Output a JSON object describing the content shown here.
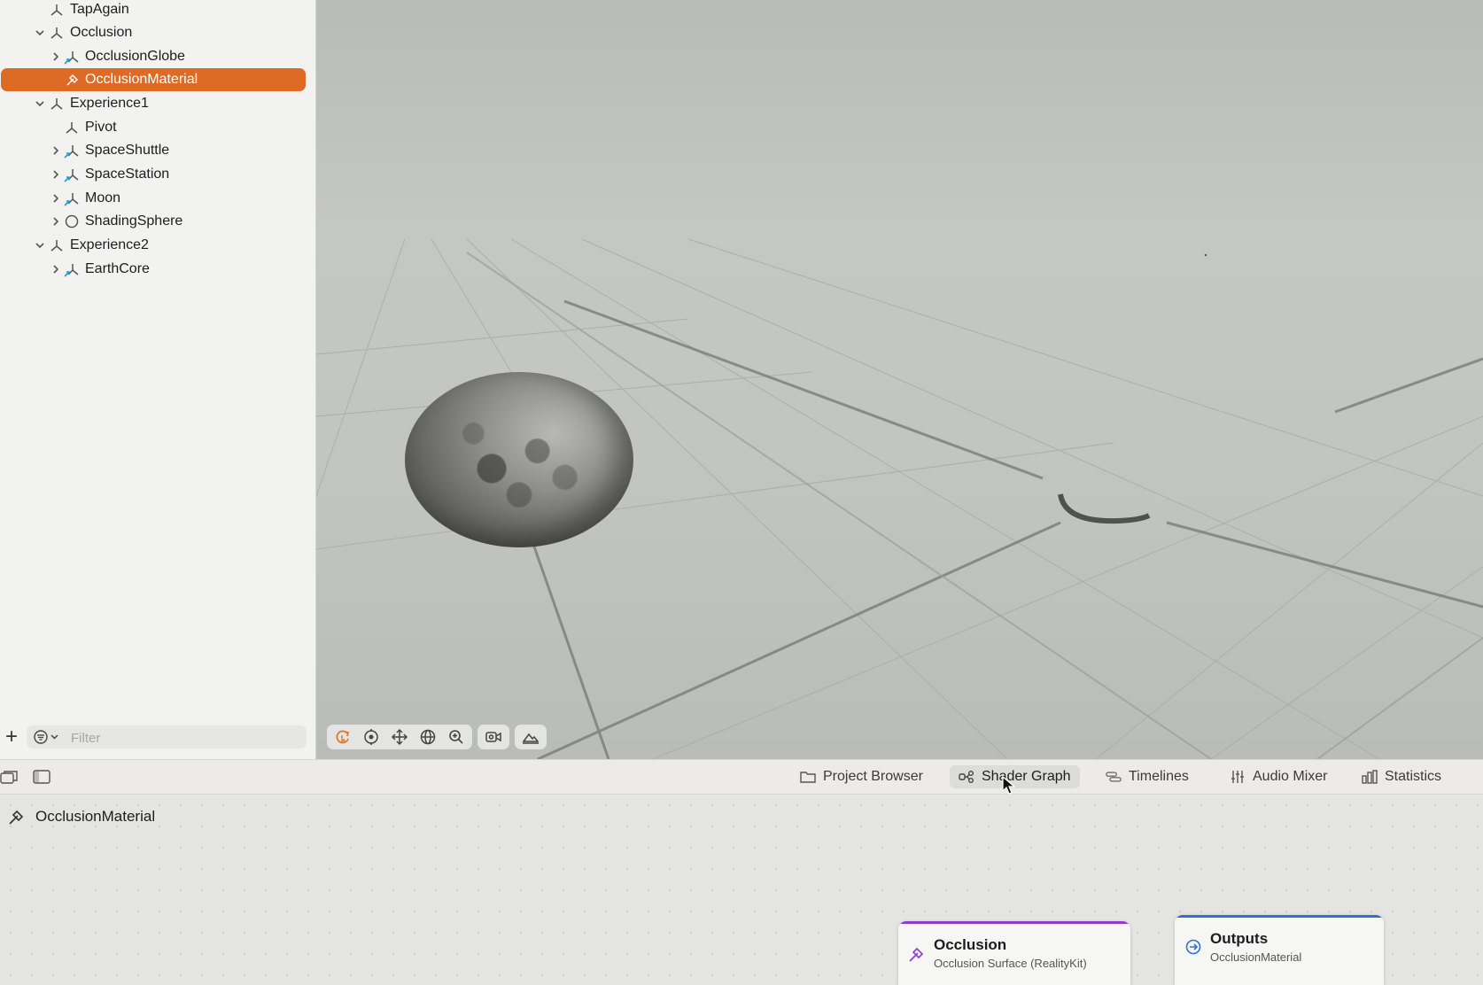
{
  "hierarchy": {
    "items": [
      {
        "label": "TapAgain",
        "icon": "entity-icon",
        "expanded": null
      },
      {
        "label": "Occlusion",
        "icon": "entity-icon",
        "expanded": true
      },
      {
        "label": "OcclusionGlobe",
        "icon": "linked-entity-icon",
        "expanded": false
      },
      {
        "label": "OcclusionMaterial",
        "icon": "material-icon",
        "expanded": null,
        "selected": true
      },
      {
        "label": "Experience1",
        "icon": "entity-icon",
        "expanded": true
      },
      {
        "label": "Pivot",
        "icon": "entity-icon",
        "expanded": null
      },
      {
        "label": "SpaceShuttle",
        "icon": "linked-entity-icon",
        "expanded": false
      },
      {
        "label": "SpaceStation",
        "icon": "linked-entity-icon",
        "expanded": false
      },
      {
        "label": "Moon",
        "icon": "linked-entity-icon",
        "expanded": false
      },
      {
        "label": "ShadingSphere",
        "icon": "sphere-icon",
        "expanded": false
      },
      {
        "label": "Experience2",
        "icon": "entity-icon",
        "expanded": true
      },
      {
        "label": "EarthCore",
        "icon": "linked-entity-icon",
        "expanded": false
      }
    ],
    "filter_placeholder": "Filter"
  },
  "bottom_tabs": [
    {
      "label": "Project Browser",
      "icon": "folder-icon"
    },
    {
      "label": "Shader Graph",
      "icon": "shader-graph-icon",
      "active": true
    },
    {
      "label": "Timelines",
      "icon": "timeline-icon"
    },
    {
      "label": "Audio Mixer",
      "icon": "mixer-icon"
    },
    {
      "label": "Statistics",
      "icon": "chart-icon"
    }
  ],
  "shader_graph": {
    "material_name": "OcclusionMaterial",
    "nodes": [
      {
        "title": "Occlusion",
        "subtitle": "Occlusion Surface (RealityKit)",
        "accent": "#8a3ccf"
      },
      {
        "title": "Outputs",
        "subtitle": "OcclusionMaterial",
        "accent": "#2f6fd6"
      }
    ]
  },
  "colors": {
    "selection": "#dd6a25",
    "active_tool": "#e07a2a"
  }
}
